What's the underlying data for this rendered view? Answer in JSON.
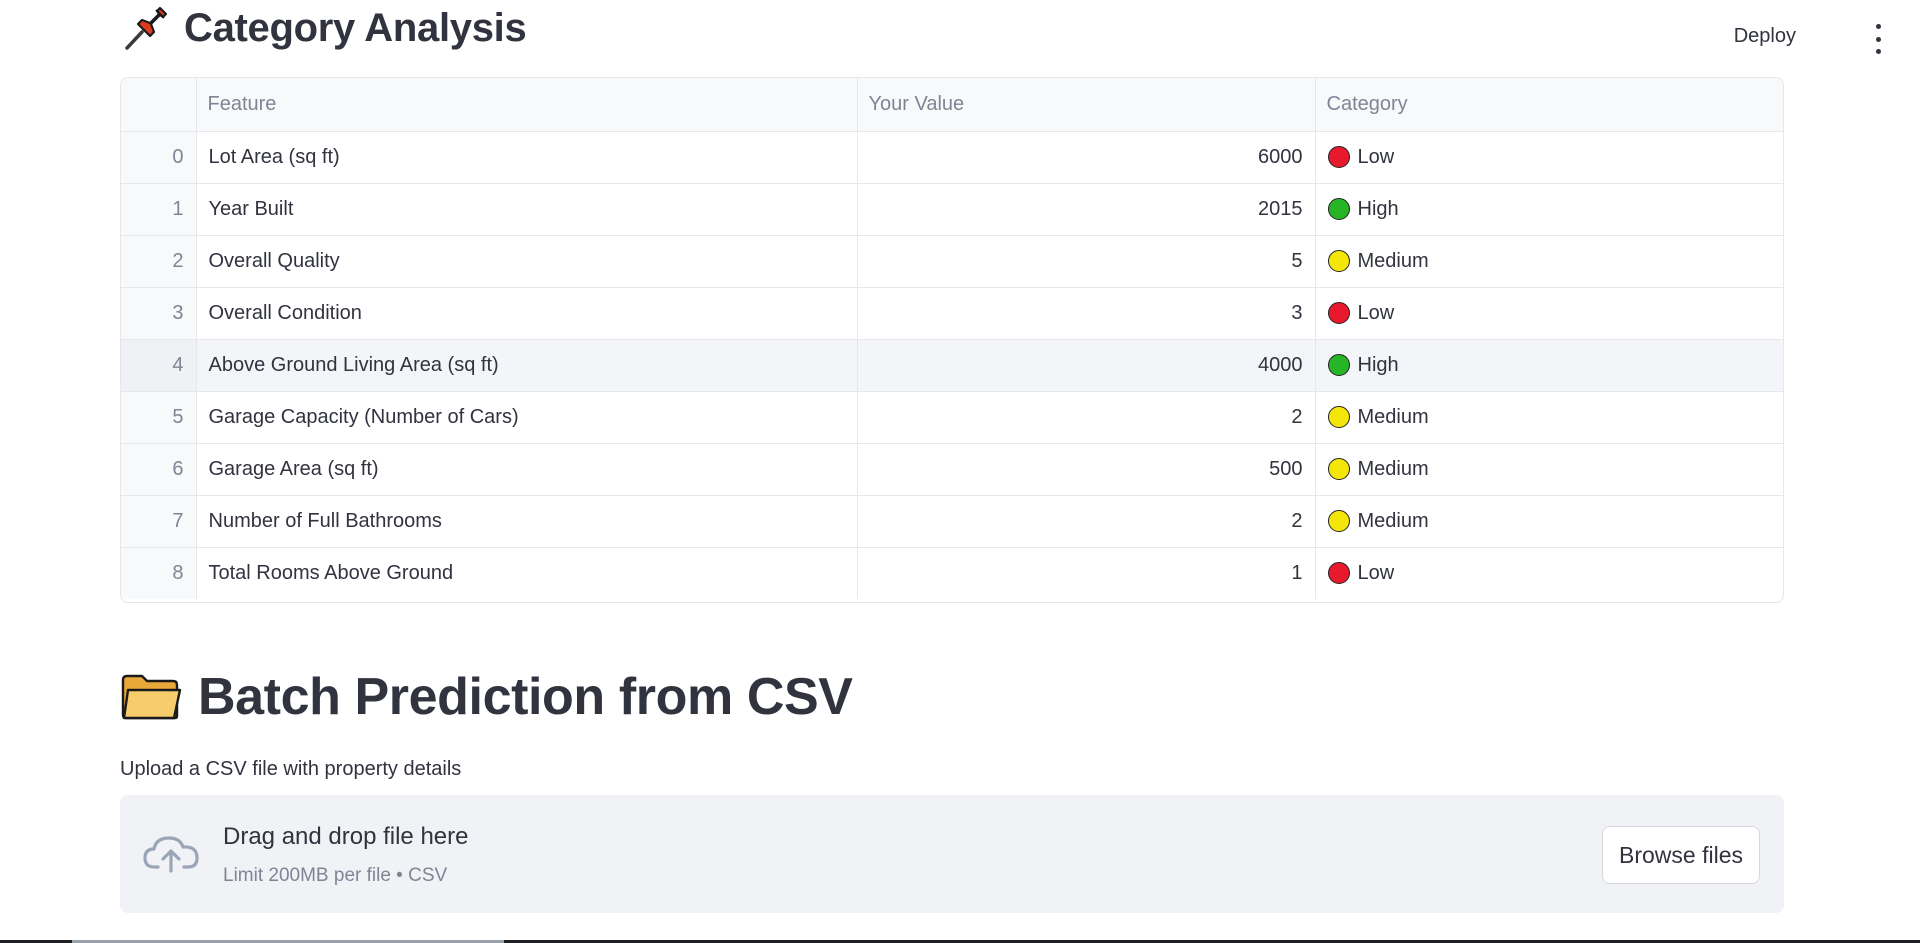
{
  "header": {
    "deploy_label": "Deploy",
    "menu_icon": "kebab-menu-icon"
  },
  "category_section": {
    "icon": "pushpin-icon",
    "title": "Category Analysis",
    "columns": [
      "",
      "Feature",
      "Your Value",
      "Category"
    ],
    "rows": [
      {
        "index": "0",
        "feature": "Lot Area (sq ft)",
        "value": "6000",
        "category": "Low",
        "color": "#e8192c"
      },
      {
        "index": "1",
        "feature": "Year Built",
        "value": "2015",
        "category": "High",
        "color": "#27b427"
      },
      {
        "index": "2",
        "feature": "Overall Quality",
        "value": "5",
        "category": "Medium",
        "color": "#f5e60a"
      },
      {
        "index": "3",
        "feature": "Overall Condition",
        "value": "3",
        "category": "Low",
        "color": "#e8192c"
      },
      {
        "index": "4",
        "feature": "Above Ground Living Area (sq ft)",
        "value": "4000",
        "category": "High",
        "color": "#27b427"
      },
      {
        "index": "5",
        "feature": "Garage Capacity (Number of Cars)",
        "value": "2",
        "category": "Medium",
        "color": "#f5e60a"
      },
      {
        "index": "6",
        "feature": "Garage Area (sq ft)",
        "value": "500",
        "category": "Medium",
        "color": "#f5e60a"
      },
      {
        "index": "7",
        "feature": "Number of Full Bathrooms",
        "value": "2",
        "category": "Medium",
        "color": "#f5e60a"
      },
      {
        "index": "8",
        "feature": "Total Rooms Above Ground",
        "value": "1",
        "category": "Low",
        "color": "#e8192c"
      }
    ]
  },
  "batch_section": {
    "icon": "folder-icon",
    "title": "Batch Prediction from CSV",
    "upload_label": "Upload a CSV file with property details",
    "dropzone": {
      "icon": "cloud-upload-icon",
      "title": "Drag and drop file here",
      "subtitle": "Limit 200MB per file • CSV",
      "browse_label": "Browse files"
    }
  },
  "colors": {
    "text": "#31333f",
    "muted": "#808495",
    "dropzone_bg": "#f0f2f6",
    "low": "#e8192c",
    "medium": "#f5e60a",
    "high": "#27b427"
  }
}
